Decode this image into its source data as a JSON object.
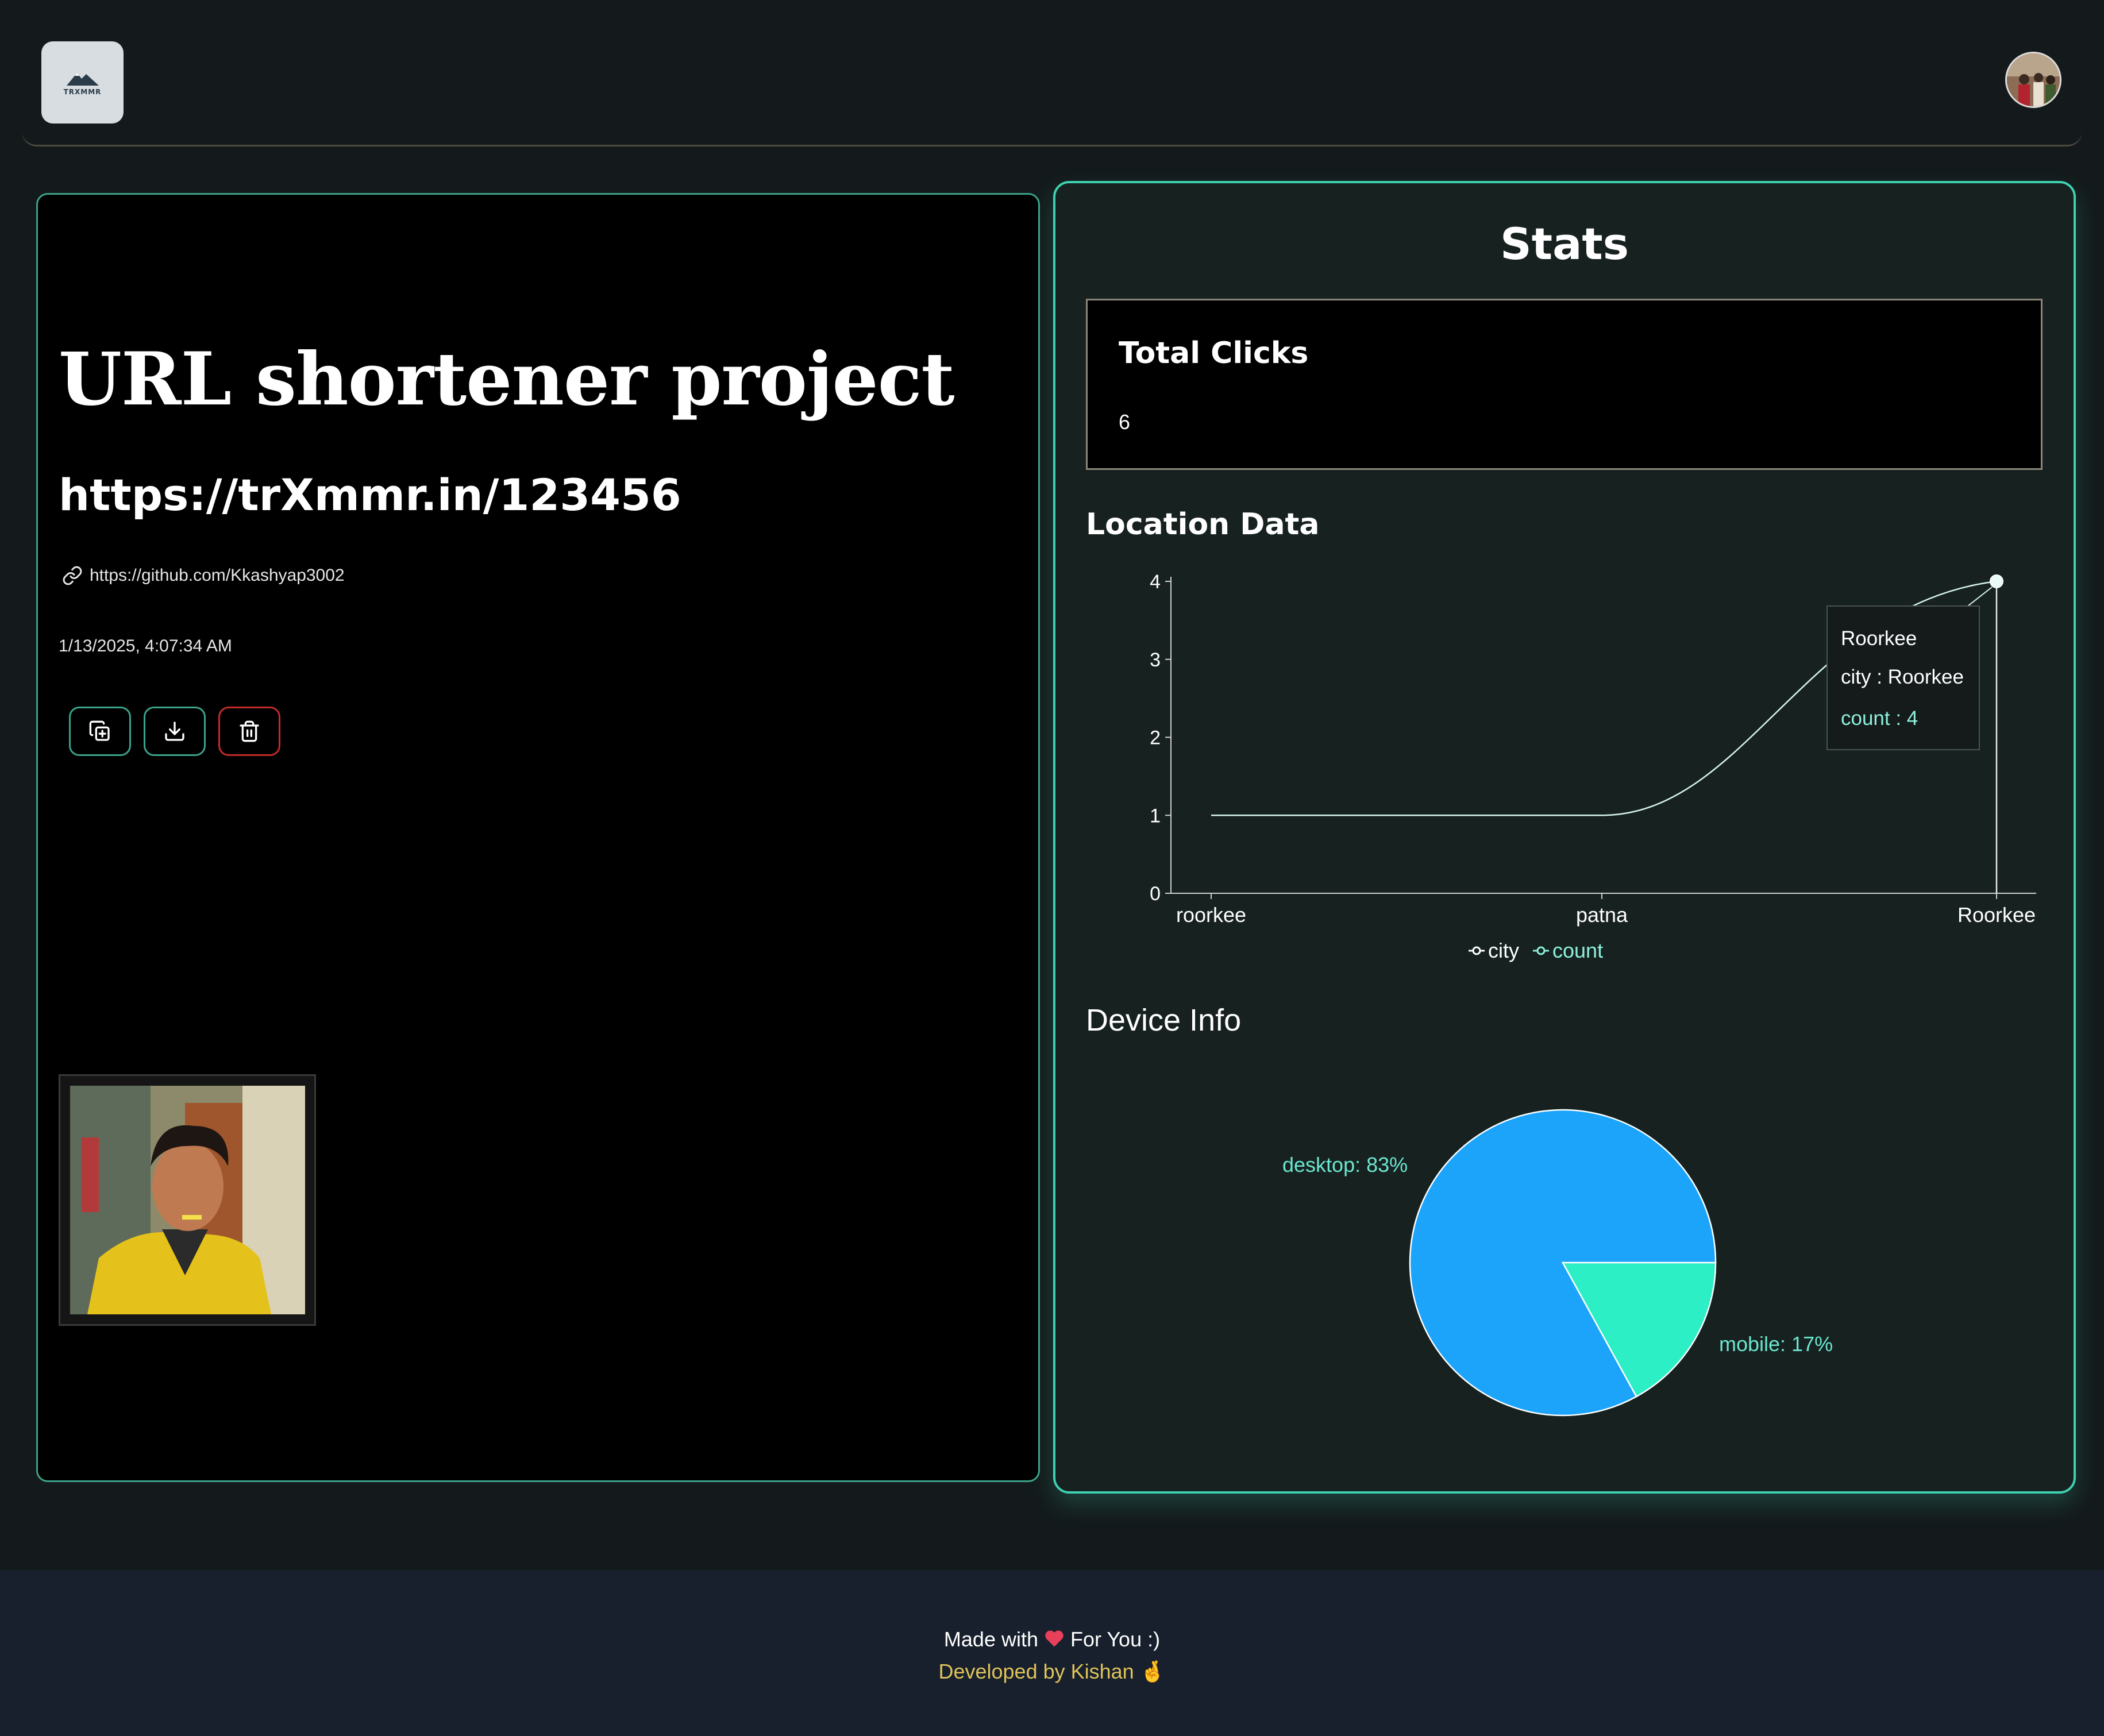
{
  "header": {
    "logo_text": "TRXMMR"
  },
  "link": {
    "title": "URL shortener project",
    "short_url": "https://trXmmr.in/123456",
    "original_url": "https://github.com/Kkashyap3002",
    "created_at": "1/13/2025, 4:07:34 AM"
  },
  "actions": {
    "copy_icon": "copy-icon",
    "download_icon": "download-icon",
    "delete_icon": "trash-icon"
  },
  "stats": {
    "title": "Stats",
    "total_clicks_label": "Total Clicks",
    "total_clicks_value": "6",
    "location_title": "Location Data",
    "device_title": "Device Info"
  },
  "chart_data": [
    {
      "type": "line",
      "x": [
        "roorkee",
        "patna",
        "Roorkee"
      ],
      "series": [
        {
          "name": "city",
          "values": [
            null,
            null,
            null
          ]
        },
        {
          "name": "count",
          "values": [
            1,
            1,
            4
          ]
        }
      ],
      "yticks": [
        "0",
        "1",
        "2",
        "3",
        "4"
      ],
      "ylim": [
        0,
        4
      ],
      "legend": [
        "city",
        "count"
      ],
      "legend_position": "bottom",
      "tooltip": {
        "title": "Roorkee",
        "lines": [
          "city : Roorkee",
          "count : 4"
        ]
      },
      "colors": {
        "line": "#d7f5ee",
        "axis": "#cfcfcf",
        "count_legend": "#8ff0dd"
      }
    },
    {
      "type": "pie",
      "slices": [
        {
          "label": "desktop",
          "value": 83,
          "text": "desktop: 83%",
          "color": "#1ca4fb"
        },
        {
          "label": "mobile",
          "value": 17,
          "text": "mobile: 17%",
          "color": "#2cefc6"
        }
      ]
    }
  ],
  "footer": {
    "made_with": "Made with",
    "for_you": "For You :)",
    "developed_by": "Developed by Kishan 🤞"
  },
  "colors": {
    "accent": "#3fd1b0",
    "delete": "#c42a2a",
    "footer_highlight": "#e0c35a"
  }
}
